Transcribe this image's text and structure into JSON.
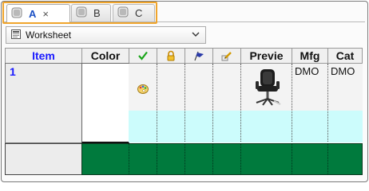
{
  "tabs": [
    {
      "label": "A",
      "close": "×",
      "active": true
    },
    {
      "label": "B",
      "close": "",
      "active": false
    },
    {
      "label": "C",
      "close": "",
      "active": false
    }
  ],
  "dropdown": {
    "selected": "Worksheet"
  },
  "grid": {
    "headers": {
      "item": "Item",
      "color": "Color",
      "preview": "Previe",
      "mfg": "Mfg",
      "cat": "Cat"
    },
    "row": {
      "number": "1",
      "mfg": "DMO",
      "cat": "DMO"
    }
  },
  "colors": {
    "accent_tab_outline": "#f0a52c",
    "item_header": "#1a1aff",
    "row_highlight": "#ccfcfc",
    "footer_row": "#007a3d"
  },
  "icons": [
    "tab-icon",
    "worksheet-icon",
    "checkmark-icon",
    "lock-icon",
    "flag-icon",
    "edit-icon",
    "palette-icon",
    "office-chair-icon",
    "chevron-down-icon",
    "close-icon"
  ]
}
